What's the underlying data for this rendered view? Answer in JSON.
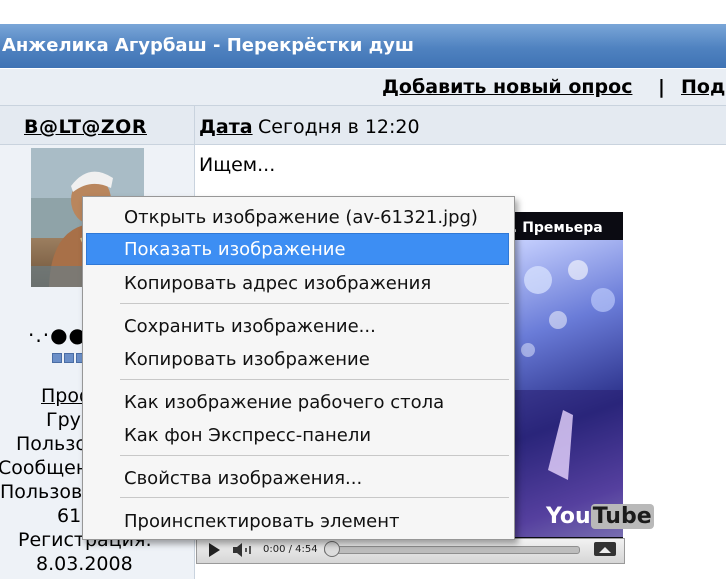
{
  "header": {
    "title": "Анжелика Агурбаш - Перекрёстки душ"
  },
  "actions": {
    "add_poll": "Добавить новый опрос",
    "separator": "|",
    "next_partial": "Под"
  },
  "post": {
    "username": "B@LT@ZOR",
    "date_label": "Дата",
    "date_value": "Сегодня в 12:20",
    "text": "Ищем..."
  },
  "user_info": {
    "rank_dots": "·.·●●",
    "reputation_squares": 6,
    "lines": [
      "Проф",
      "Груп",
      "Пользо",
      "Сообщен",
      "Пользов",
      "61",
      "Регистрация:",
      "8.03.2008"
    ]
  },
  "video": {
    "overlay_title": ". Премьера",
    "logo_you": "You",
    "logo_tube": "Tube",
    "time": "0:00 / 4:54"
  },
  "context_menu": {
    "items": [
      {
        "label": "Открыть изображение (av-61321.jpg)",
        "highlighted": false
      },
      {
        "label": "Показать изображение",
        "highlighted": true
      },
      {
        "label": "Копировать адрес изображения",
        "highlighted": false
      },
      {
        "label": "Сохранить изображение...",
        "highlighted": false
      },
      {
        "label": "Копировать изображение",
        "highlighted": false
      },
      {
        "label": "Как изображение рабочего стола",
        "highlighted": false
      },
      {
        "label": "Как фон Экспресс-панели",
        "highlighted": false
      },
      {
        "label": "Свойства изображения...",
        "highlighted": false
      },
      {
        "label": "Проинспектировать элемент",
        "highlighted": false
      }
    ]
  },
  "colors": {
    "title_bar": "#4f82c0",
    "menu_highlight": "#3d8ef3"
  }
}
